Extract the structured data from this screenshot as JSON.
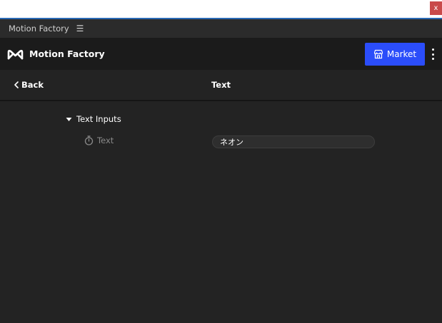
{
  "window": {
    "close_label": "x"
  },
  "panel": {
    "title": "Motion Factory",
    "menu_glyph": "☰"
  },
  "header": {
    "app_title": "Motion Factory",
    "market_label": "Market",
    "accent_color": "#2b4dfa"
  },
  "nav": {
    "back_label": "Back",
    "title": "Text"
  },
  "section": {
    "title": "Text Inputs",
    "properties": [
      {
        "label": "Text",
        "value": "ネオン"
      }
    ]
  }
}
